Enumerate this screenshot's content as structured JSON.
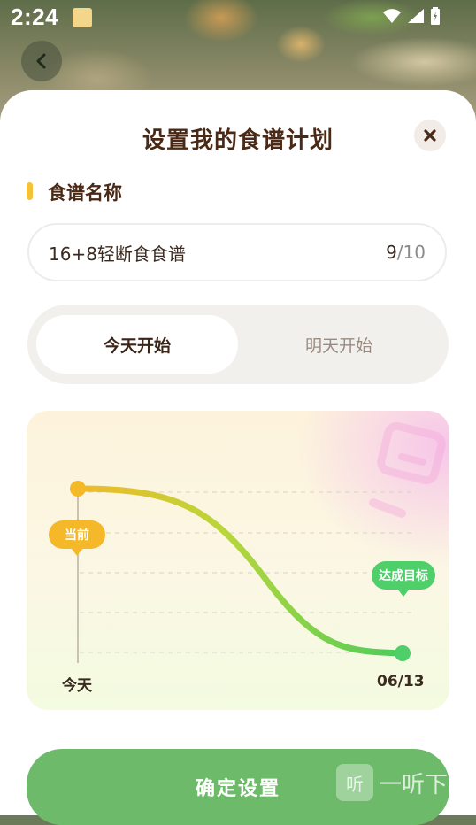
{
  "status": {
    "time": "2:24"
  },
  "sheet": {
    "title": "设置我的食谱计划",
    "section_label": "食谱名称",
    "name_field": {
      "value": "16+8轻断食食谱",
      "count": "9",
      "separator": "/",
      "max": "10"
    },
    "start_options": [
      {
        "label": "今天开始",
        "selected": true
      },
      {
        "label": "明天开始",
        "selected": false
      }
    ],
    "chart_data": {
      "type": "line",
      "x": [
        "今天",
        "06/13"
      ],
      "start_label": "当前",
      "end_label": "达成目标",
      "grid": true
    },
    "confirm_label": "确定设置"
  },
  "watermark": {
    "text": "一听下载",
    "icon_text": "听"
  },
  "colors": {
    "accent_yellow": "#f5c136",
    "start_point": "#f5b828",
    "goal_point": "#4fcf6a",
    "confirm_button": "#6dbb6a",
    "title_text": "#4a2a16"
  },
  "icons": [
    "back-arrow-icon",
    "close-icon",
    "wifi-icon",
    "signal-icon",
    "battery-icon",
    "app-notification-icon"
  ]
}
